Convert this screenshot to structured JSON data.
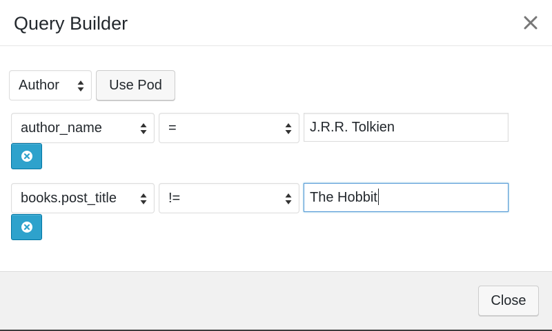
{
  "dialog": {
    "title": "Query Builder",
    "close_label": "Close"
  },
  "source": {
    "selected": "Author",
    "use_pod_label": "Use Pod"
  },
  "conditions": [
    {
      "field": "author_name",
      "operator": "=",
      "value": "J.R.R. Tolkien"
    },
    {
      "field": "books.post_title",
      "operator": "!=",
      "value": "The Hobbit"
    }
  ],
  "icons": {
    "close": "close-icon",
    "select_arrows": "up-down-arrows-icon",
    "remove": "remove-circle-icon"
  },
  "colors": {
    "remove_button": "#2ea2cc",
    "focus_border": "#5b9dd9",
    "footer_bg": "#f1f1f1"
  }
}
